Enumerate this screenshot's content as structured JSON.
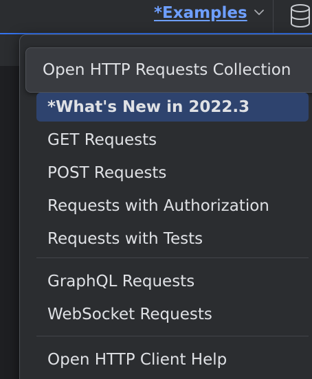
{
  "toolbar": {
    "examples_label": "*Examples",
    "icons": [
      "chevron-down-icon",
      "database-icon"
    ]
  },
  "popup": {
    "header_label": "Open HTTP Requests Collection",
    "groups": [
      {
        "items": [
          {
            "label": "*What's New in 2022.3",
            "selected": true
          },
          {
            "label": "GET Requests"
          },
          {
            "label": "POST Requests"
          },
          {
            "label": "Requests with Authorization"
          },
          {
            "label": "Requests with Tests"
          }
        ]
      },
      {
        "items": [
          {
            "label": "GraphQL Requests"
          },
          {
            "label": "WebSocket Requests"
          }
        ]
      },
      {
        "items": [
          {
            "label": "Open HTTP Client Help"
          }
        ]
      }
    ]
  },
  "colors": {
    "accent": "#3574f0",
    "link": "#6e9fff",
    "selection": "#2e436e",
    "background": "#1e1f22",
    "panel": "#2b2d30"
  }
}
